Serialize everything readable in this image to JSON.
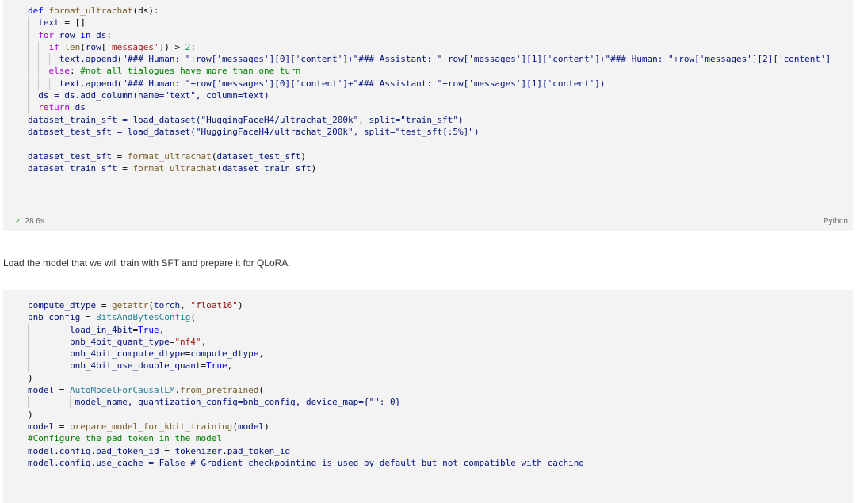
{
  "cell1": {
    "status_icon": "check-icon",
    "execution_time": "28.6s",
    "language": "Python"
  },
  "markdown": {
    "text": "Load the model that we will train with SFT and prepare it for QLoRA."
  },
  "code_text": {
    "c1_l5": "text.append(\"### Human: \"+row['messages'][0]['content']+\"### Assistant: \"+row['messages'][1]['content']+\"### Human: \"+row['messages'][2]['content']",
    "c1_l7": "text.append(\"### Human: \"+row['messages'][0]['content']+\"### Assistant: \"+row['messages'][1]['content'])",
    "c1_l8": "ds = ds.add_column(name=\"text\", column=text)",
    "c1_l10": "dataset_train_sft = load_dataset(\"HuggingFaceH4/ultrachat_200k\", split=\"train_sft\")",
    "c1_l11": "dataset_test_sft = load_dataset(\"HuggingFaceH4/ultrachat_200k\", split=\"test_sft[:5%]\")",
    "c2_l10": "model_name, quantization_config=bnb_config, device_map={\"\": 0}",
    "c2_l15": "model.config.use_cache = False # Gradient checkpointing is used by default but not compatible with caching"
  }
}
